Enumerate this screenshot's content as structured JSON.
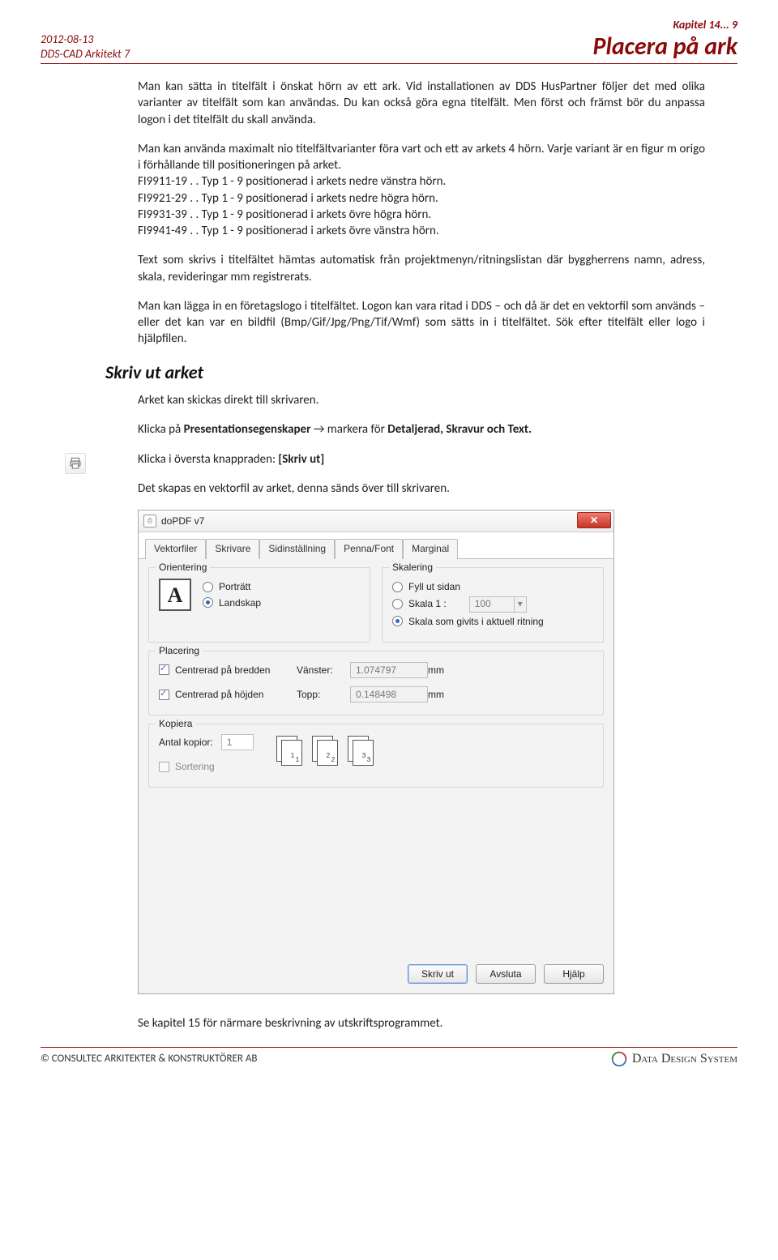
{
  "header": {
    "date": "2012-08-13",
    "product": "DDS-CAD Arkitekt 7",
    "chapter": "Kapitel 14... 9",
    "page_title": "Placera på ark"
  },
  "paragraphs": {
    "p1": "Man kan sätta in titelfält i önskat hörn av ett ark. Vid installationen av DDS HusPartner följer det med olika varianter av titelfält som kan användas. Du kan också göra egna titelfält. Men först och främst bör du anpassa logon i det titelfält du skall använda.",
    "p2": "Man kan använda maximalt nio titelfältvarianter föra vart och ett av arkets 4 hörn. Varje variant är en figur m origo i förhållande till positioneringen på arket.",
    "p2_l1": "FI9911-19 . . Typ 1 - 9 positionerad i arkets nedre vänstra hörn.",
    "p2_l2": "FI9921-29 . . Typ 1 - 9 positionerad i arkets nedre högra hörn.",
    "p2_l3": "FI9931-39 . . Typ 1 - 9 positionerad i arkets övre högra hörn.",
    "p2_l4": "FI9941-49 . . Typ 1 - 9 positionerad i arkets övre vänstra hörn.",
    "p3": "Text som skrivs i titelfältet hämtas automatisk från projektmenyn/ritningslistan där byggherrens namn, adress, skala, revideringar mm registrerats.",
    "p4": "Man kan lägga in en företagslogo i titelfältet. Logon kan vara ritad i DDS – och då är det en vektorfil som används – eller det kan var en bildfil (Bmp/Gif/Jpg/Png/Tif/Wmf) som sätts in i titelfältet. Sök efter titelfält eller logo i hjälpfilen.",
    "h2": "Skriv ut arket",
    "p5": "Arket kan skickas direkt till skrivaren.",
    "p6_a": "Klicka på ",
    "p6_b": "Presentationsegenskaper",
    "p6_c": " → markera för ",
    "p6_d": "Detaljerad, Skravur och Text.",
    "p7_a": "Klicka i översta knappraden: ",
    "p7_b": "[Skriv ut]",
    "p8": "Det skapas en vektorfil av arket, denna sänds över till skrivaren.",
    "p9": "Se kapitel 15 för närmare beskrivning av utskriftsprogrammet."
  },
  "dialog": {
    "title": "doPDF v7",
    "tabs": [
      "Vektorfiler",
      "Skrivare",
      "Sidinställning",
      "Penna/Font",
      "Marginal"
    ],
    "active_tab": 2,
    "orientering": {
      "legend": "Orientering",
      "glyph": "A",
      "portrait": "Porträtt",
      "landscape": "Landskap"
    },
    "skalering": {
      "legend": "Skalering",
      "fill": "Fyll ut sidan",
      "scale1": "Skala 1 :",
      "scale_value": "100",
      "as_drawn": "Skala som givits i aktuell ritning"
    },
    "placering": {
      "legend": "Placering",
      "center_w": "Centrerad på bredden",
      "center_h": "Centrerad på höjden",
      "left_label": "Vänster:",
      "left_value": "1.074797",
      "top_label": "Topp:",
      "top_value": "0.148498",
      "unit": "mm"
    },
    "kopiera": {
      "legend": "Kopiera",
      "count_label": "Antal kopior:",
      "count_value": "1",
      "collate": "Sortering",
      "stack_labels": [
        "1",
        "2",
        "3"
      ]
    },
    "buttons": {
      "print": "Skriv ut",
      "close": "Avsluta",
      "help": "Hjälp"
    }
  },
  "footer": {
    "copyright": "©  CONSULTEC ARKITEKTER & KONSTRUKTÖRER AB",
    "brand": "Data Design System"
  }
}
